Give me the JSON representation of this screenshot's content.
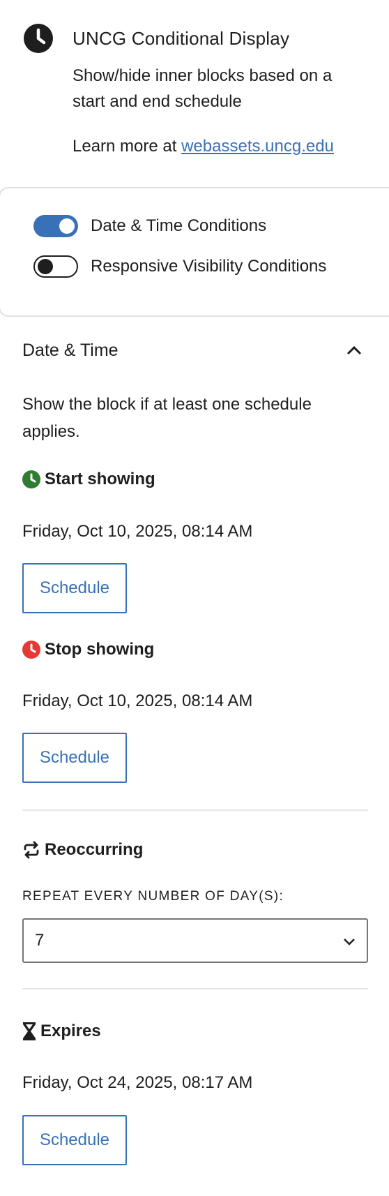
{
  "block": {
    "title": "UNCG Conditional Display",
    "description": "Show/hide inner blocks based on a start and end schedule",
    "learn_prefix": "Learn more at ",
    "learn_link": "webassets.uncg.edu",
    "icon": "clock-icon"
  },
  "toggles": [
    {
      "label": "Date & Time Conditions",
      "checked": true
    },
    {
      "label": "Responsive Visibility Conditions",
      "checked": false
    }
  ],
  "panel": {
    "title": "Date & Time",
    "help": "Show the block if at least one schedule applies.",
    "start": {
      "heading": "Start showing",
      "value": "Friday, Oct 10, 2025, 08:14 AM",
      "button": "Schedule",
      "icon_color": "#2e7d32"
    },
    "stop": {
      "heading": "Stop showing",
      "value": "Friday, Oct 10, 2025, 08:14 AM",
      "button": "Schedule",
      "icon_color": "#e53935"
    },
    "reoccurring": {
      "heading": "Reoccurring",
      "label": "Repeat every number of day(s):",
      "selected": "7"
    },
    "expires": {
      "heading": "Expires",
      "value": "Friday, Oct 24, 2025, 08:17 AM",
      "button": "Schedule"
    }
  },
  "colors": {
    "accent": "#3871b8",
    "text": "#1e1e1e"
  }
}
